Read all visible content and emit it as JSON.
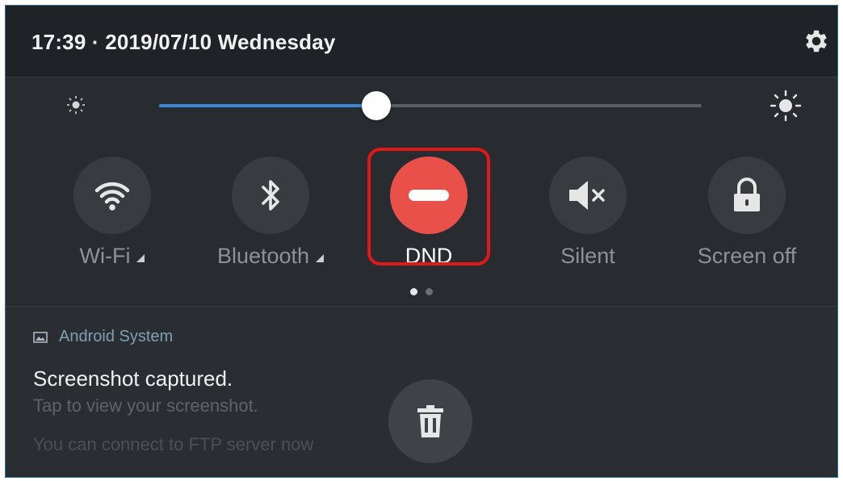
{
  "status_bar": {
    "datetime": "17:39 · 2019/07/10 Wednesday",
    "settings_icon": "gear-icon"
  },
  "brightness": {
    "level_fraction": 0.4,
    "low_icon": "brightness-low-icon",
    "high_icon": "brightness-high-icon"
  },
  "quick_settings": [
    {
      "key": "wifi",
      "label": "Wi-Fi",
      "icon": "wifi-icon",
      "active": false,
      "expandable": true
    },
    {
      "key": "bluetooth",
      "label": "Bluetooth",
      "icon": "bluetooth-icon",
      "active": false,
      "expandable": true
    },
    {
      "key": "dnd",
      "label": "DND",
      "icon": "do-not-disturb-icon",
      "active": true,
      "expandable": false
    },
    {
      "key": "silent",
      "label": "Silent",
      "icon": "speaker-mute-icon",
      "active": false,
      "expandable": false
    },
    {
      "key": "screen_off",
      "label": "Screen off",
      "icon": "unlock-icon",
      "active": false,
      "expandable": false
    }
  ],
  "pager": {
    "total": 2,
    "current": 1
  },
  "notification": {
    "app": "Android System",
    "app_icon": "screenshot-icon",
    "title": "Screenshot captured.",
    "body": "Tap to view your screenshot.",
    "secondary": "You can connect to FTP server now",
    "action_icon": "trash-icon"
  },
  "colors": {
    "accent": "#3b87d8",
    "dnd_active": "#e9504a",
    "highlight_border": "#e01818"
  }
}
